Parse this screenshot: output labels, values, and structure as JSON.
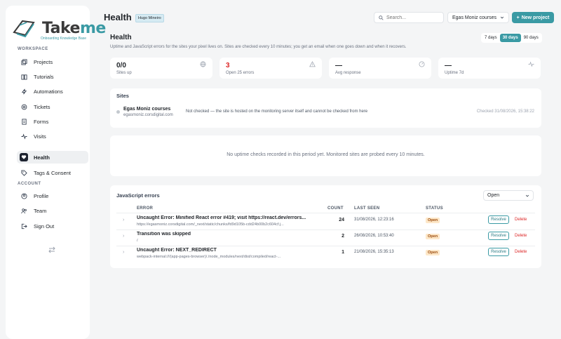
{
  "brand": {
    "name_part1": "Take",
    "name_part2": "me",
    "tagline": "Onboarding Knowledge Base"
  },
  "sidebar": {
    "workspace_label": "WORKSPACE",
    "account_label": "ACCOUNT",
    "workspace_items": [
      {
        "label": "Projects",
        "icon": "projects-icon"
      },
      {
        "label": "Tutorials",
        "icon": "book-icon"
      },
      {
        "label": "Automations",
        "icon": "bolt-icon"
      },
      {
        "label": "Tickets",
        "icon": "ticket-icon"
      },
      {
        "label": "Forms",
        "icon": "form-icon"
      },
      {
        "label": "Visits",
        "icon": "pulse-icon"
      },
      {
        "label": "Health",
        "icon": "heart-icon",
        "active": true
      },
      {
        "label": "Tags & Consent",
        "icon": "tag-icon"
      }
    ],
    "account_items": [
      {
        "label": "Profile",
        "icon": "user-circle-icon"
      },
      {
        "label": "Team",
        "icon": "team-icon"
      },
      {
        "label": "Sign Out",
        "icon": "sign-out-icon"
      }
    ]
  },
  "header": {
    "title": "Health",
    "user_badge": "Hugo Mineiro",
    "search_placeholder": "Search...",
    "course_select": "Egas Moniz courses",
    "new_project_label": "New project"
  },
  "health": {
    "title": "Health",
    "subtitle": "Uptime and JavaScript errors for the sites your pixel lives on. Sites are checked every 10 minutes; you get an email when one goes down and when it recovers.",
    "ranges": [
      "7 days",
      "30 days",
      "90 days"
    ],
    "active_range": "30 days"
  },
  "stats": [
    {
      "value": "0/0",
      "label": "Sites up",
      "icon": "globe-icon"
    },
    {
      "value": "3",
      "label": "Open 25 errors",
      "icon": "warning-icon"
    },
    {
      "value": "—",
      "label": "Avg response",
      "icon": "gauge-icon"
    },
    {
      "value": "—",
      "label": "Uptime 7d",
      "icon": "activity-icon"
    }
  ],
  "sites": {
    "title": "Sites",
    "items": [
      {
        "name": "Egas Moniz courses",
        "domain": "egasmoniz.corsdigital.com",
        "status": "Not checked — the site is hosted on the monitoring server itself and cannot be checked from here",
        "checked": "Checked 31/08/2026, 15:38:22"
      }
    ]
  },
  "uptime": {
    "empty_message": "No uptime checks recorded in this period yet. Monitored sites are probed every 10 minutes."
  },
  "errors": {
    "title": "JavaScript errors",
    "filter": "Open",
    "columns": {
      "error": "ERROR",
      "count": "COUNT",
      "last_seen": "LAST SEEN",
      "status": "STATUS"
    },
    "resolve_label": "Resolve",
    "delete_label": "Delete",
    "rows": [
      {
        "message": "Uncaught Error: Minified React error #419; visit https://react.dev/errors...",
        "source": "https://egasmoniz.corsdigital.com/_next/static/chunks/fd9d105b-cdd24b00b2c604cf.j...",
        "count": "24",
        "last_seen": "31/08/2026, 12:23:16",
        "status": "Open"
      },
      {
        "message": "Transition was skipped",
        "source": "/",
        "count": "2",
        "last_seen": "26/08/2026, 10:53:40",
        "status": "Open"
      },
      {
        "message": "Uncaught Error: NEXT_REDIRECT",
        "source": "webpack-internal:///(app-pages-browser)/./node_modules/next/dist/compiled/react-...",
        "count": "1",
        "last_seen": "21/08/2026, 15:35:13",
        "status": "Open"
      }
    ]
  },
  "colors": {
    "accent": "#3a9aa4",
    "danger": "#dc2626",
    "open_badge_bg": "#fde7c8",
    "sidebar_active_icon": "#1d2330"
  }
}
